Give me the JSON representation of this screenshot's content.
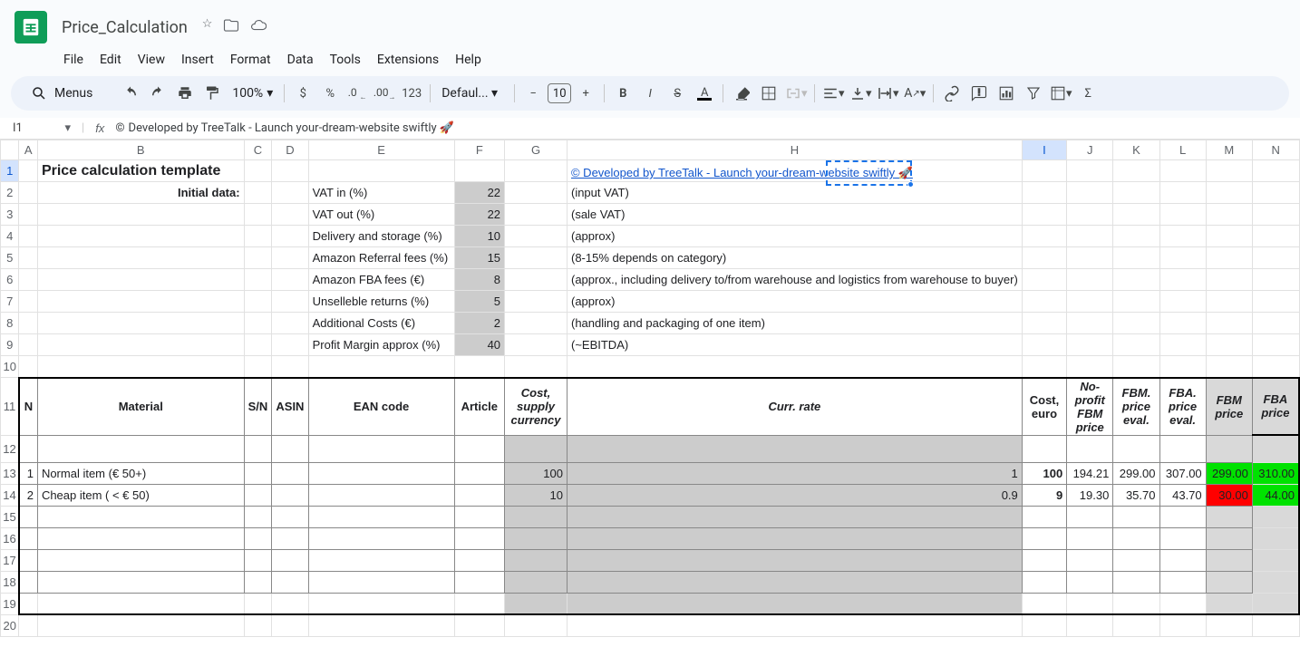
{
  "app": {
    "doc_title": "Price_Calculation",
    "menus_label": "Menus",
    "zoom": "100%",
    "font_name": "Defaul...",
    "font_size": "10"
  },
  "menu": {
    "file": "File",
    "edit": "Edit",
    "view": "View",
    "insert": "Insert",
    "format": "Format",
    "data": "Data",
    "tools": "Tools",
    "extensions": "Extensions",
    "help": "Help"
  },
  "toolbar": {
    "currency": "$",
    "percent": "%",
    "dec_dec": ".0",
    "dec_inc": ".00",
    "numfmt": "123"
  },
  "fx": {
    "cell_ref": "I1",
    "formula_text": "Developed by TreeTalk - Launch your-dream-website swiftly 🚀",
    "copyright": "©"
  },
  "columns": [
    "",
    "A",
    "B",
    "C",
    "D",
    "E",
    "F",
    "G",
    "H",
    "I",
    "J",
    "K",
    "L",
    "M",
    "N"
  ],
  "cells": {
    "B1": "Price calculation template",
    "B2": "Initial data:",
    "E2": "VAT in (%)",
    "F2": "22",
    "H2": "(input VAT)",
    "E3": "VAT out (%)",
    "F3": "22",
    "H3": "(sale VAT)",
    "E4": "Delivery and storage (%)",
    "F4": "10",
    "H4": "(approx)",
    "E5": "Amazon Referral fees (%)",
    "F5": "15",
    "H5": "(8-15% depends on category)",
    "E6": "Amazon FBA fees (€)",
    "F6": "8",
    "H6": "(approx., including delivery to/from warehouse and logistics from warehouse to buyer)",
    "E7": "Unselleble returns (%)",
    "F7": "5",
    "H7": "(approx)",
    "E8": "Additional Costs (€)",
    "F8": "2",
    "H8": "(handling and packaging of one item)",
    "E9": "Profit Margin approx (%)",
    "F9": "40",
    "H9": "(~EBITDA)",
    "I1_link": "©  Developed by TreeTalk - Launch your-dream-website swiftly 🚀",
    "hdr": {
      "A": "N",
      "B": "Material",
      "C": "S/N",
      "D": "ASIN",
      "E": "EAN code",
      "F": "Article",
      "G": "Cost, supply currency",
      "H": "Curr. rate",
      "I": "Cost, euro",
      "J": "No-profit FBM price",
      "K": "FBM. price eval.",
      "L": "FBA. price eval.",
      "M": "FBM price",
      "N": "FBA price"
    },
    "r13": {
      "A": "1",
      "B": "Normal item (€ 50+)",
      "G": "100",
      "H": "1",
      "I": "100",
      "J": "194.21",
      "K": "299.00",
      "L": "307.00",
      "M": "299.00",
      "N": "310.00"
    },
    "r14": {
      "A": "2",
      "B": "Cheap item ( < € 50)",
      "G": "10",
      "H": "0.9",
      "I": "9",
      "J": "19.30",
      "K": "35.70",
      "L": "43.70",
      "M": "30.00",
      "N": "44.00"
    }
  },
  "chart_data": {
    "type": "table",
    "title": "Price calculation template",
    "parameters": [
      {
        "label": "VAT in (%)",
        "value": 22,
        "note": "(input VAT)"
      },
      {
        "label": "VAT out (%)",
        "value": 22,
        "note": "(sale VAT)"
      },
      {
        "label": "Delivery and storage (%)",
        "value": 10,
        "note": "(approx)"
      },
      {
        "label": "Amazon Referral fees (%)",
        "value": 15,
        "note": "(8-15% depends on category)"
      },
      {
        "label": "Amazon FBA fees (€)",
        "value": 8,
        "note": "(approx., including delivery to/from warehouse and logistics from warehouse to buyer)"
      },
      {
        "label": "Unselleble returns (%)",
        "value": 5,
        "note": "(approx)"
      },
      {
        "label": "Additional Costs (€)",
        "value": 2,
        "note": "(handling and packaging of one item)"
      },
      {
        "label": "Profit Margin approx (%)",
        "value": 40,
        "note": "(~EBITDA)"
      }
    ],
    "columns": [
      "N",
      "Material",
      "S/N",
      "ASIN",
      "EAN code",
      "Article",
      "Cost, supply currency",
      "Curr. rate",
      "Cost, euro",
      "No-profit FBM price",
      "FBM. price eval.",
      "FBA. price eval.",
      "FBM price",
      "FBA price"
    ],
    "rows": [
      {
        "N": 1,
        "Material": "Normal item (€ 50+)",
        "Cost_supply": 100,
        "Curr_rate": 1,
        "Cost_euro": 100,
        "NoProfitFBM": 194.21,
        "FBM_eval": 299.0,
        "FBA_eval": 307.0,
        "FBM_price": 299.0,
        "FBA_price": 310.0,
        "FBM_flag": "ok",
        "FBA_flag": "ok"
      },
      {
        "N": 2,
        "Material": "Cheap item ( < € 50)",
        "Cost_supply": 10,
        "Curr_rate": 0.9,
        "Cost_euro": 9,
        "NoProfitFBM": 19.3,
        "FBM_eval": 35.7,
        "FBA_eval": 43.7,
        "FBM_price": 30.0,
        "FBA_price": 44.0,
        "FBM_flag": "bad",
        "FBA_flag": "ok"
      }
    ]
  }
}
